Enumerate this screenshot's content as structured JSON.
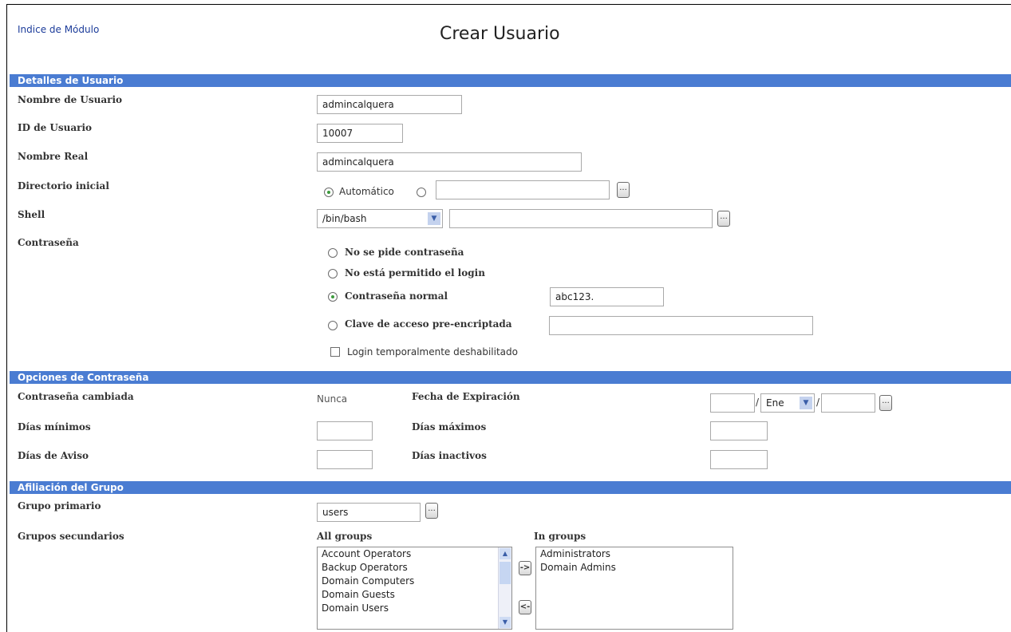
{
  "header": {
    "module_index_link": "Indice de Módulo",
    "page_title": "Crear Usuario"
  },
  "user_details": {
    "section_title": "Detalles de Usuario",
    "username": {
      "label": "Nombre de Usuario",
      "value": "admincalquera"
    },
    "user_id": {
      "label": "ID de Usuario",
      "value": "10007"
    },
    "real_name": {
      "label": "Nombre Real",
      "value": "admincalquera"
    },
    "home_dir": {
      "label": "Directorio inicial",
      "automatic_label": "Automático",
      "value": ""
    },
    "shell": {
      "label": "Shell",
      "selected": "/bin/bash",
      "value": ""
    },
    "password": {
      "label": "Contraseña",
      "opt_none": "No se pide contraseña",
      "opt_no_login": "No está permitido el login",
      "opt_normal": "Contraseña normal",
      "normal_value": "abc123.",
      "opt_preencrypted": "Clave de acceso pre-encriptada",
      "preencrypted_value": "",
      "disabled_label": "Login temporalmente deshabilitado"
    },
    "browse_label": "..."
  },
  "password_options": {
    "section_title": "Opciones de Contraseña",
    "changed_label": "Contraseña cambiada",
    "changed_value": "Nunca",
    "expiry_label": "Fecha de Expiración",
    "expiry_month": "Ene",
    "slash": "/",
    "min_days_label": "Días mínimos",
    "max_days_label": "Días máximos",
    "warn_days_label": "Días de Aviso",
    "inactive_days_label": "Días inactivos"
  },
  "group_membership": {
    "section_title": "Afiliación del Grupo",
    "primary_label": "Grupo primario",
    "primary_value": "users",
    "secondary_label": "Grupos secundarios",
    "all_groups_label": "All groups",
    "in_groups_label": "In groups",
    "all_groups": [
      "Account Operators",
      "Backup Operators",
      "Domain Computers",
      "Domain Guests",
      "Domain Users"
    ],
    "in_groups": [
      "Administrators",
      "Domain Admins"
    ],
    "add_label": "->",
    "remove_label": "<-"
  },
  "colors": {
    "section_bar": "#4a7cd2",
    "radio_selected": "#3d9a3d",
    "link": "#1c3c9a"
  }
}
